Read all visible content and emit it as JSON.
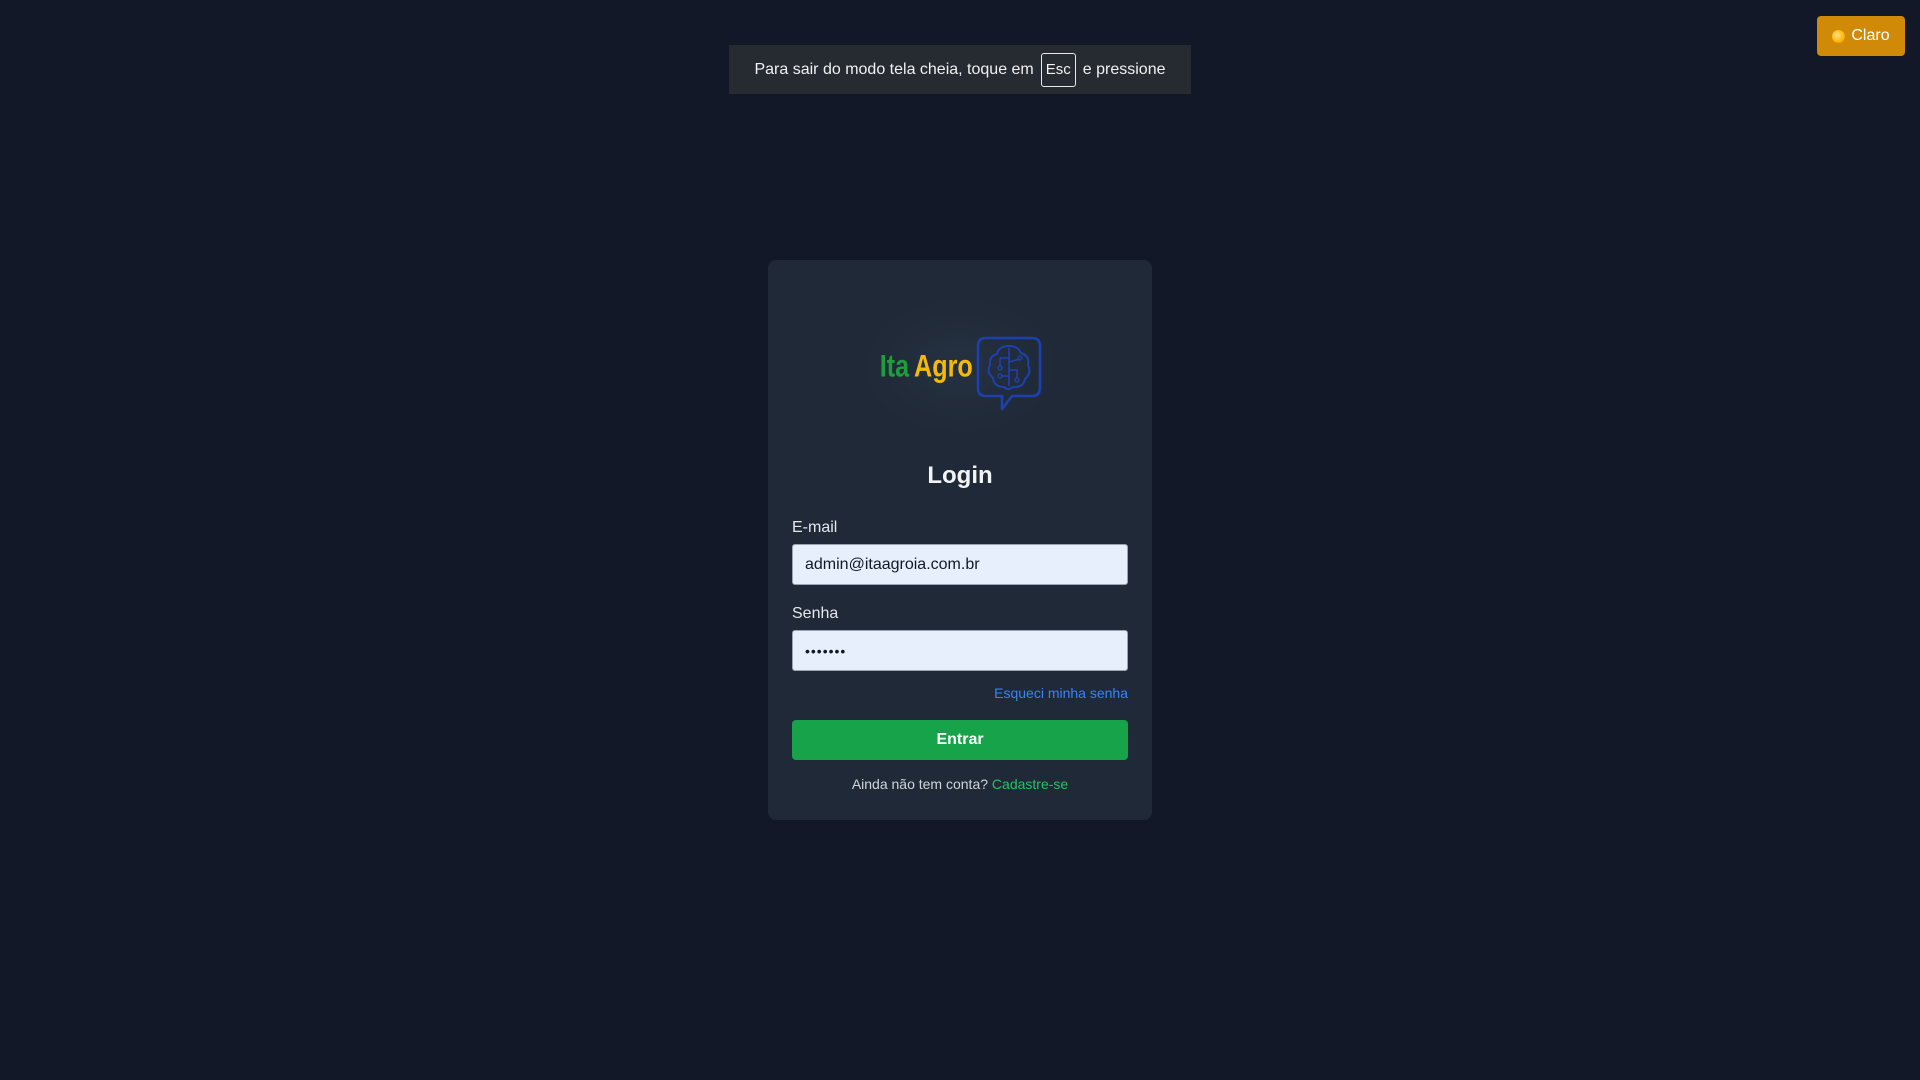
{
  "fullscreen_notice": {
    "before": "Para sair do modo tela cheia, toque em",
    "key": "Esc",
    "after": "e pressione"
  },
  "theme_toggle": {
    "label": "Claro",
    "icon": "sun-icon",
    "color": "#d08a08"
  },
  "logo": {
    "word1": "Ita",
    "word2": "Agro",
    "word1_color": "#1f9d3a",
    "word2_color": "#f5b80c",
    "icon": "brain-chat-icon",
    "icon_color": "#1e40af"
  },
  "login": {
    "title": "Login",
    "email_label": "E-mail",
    "email_value": "admin@itaagroia.com.br",
    "password_label": "Senha",
    "password_value": "•••••••",
    "forgot_link": "Esqueci minha senha",
    "submit_label": "Entrar",
    "signup_prompt": "Ainda não tem conta?",
    "signup_link": "Cadastre-se"
  },
  "colors": {
    "background": "#121827",
    "card": "#1f2937",
    "primary": "#16a34a",
    "link": "#3b82f6"
  }
}
